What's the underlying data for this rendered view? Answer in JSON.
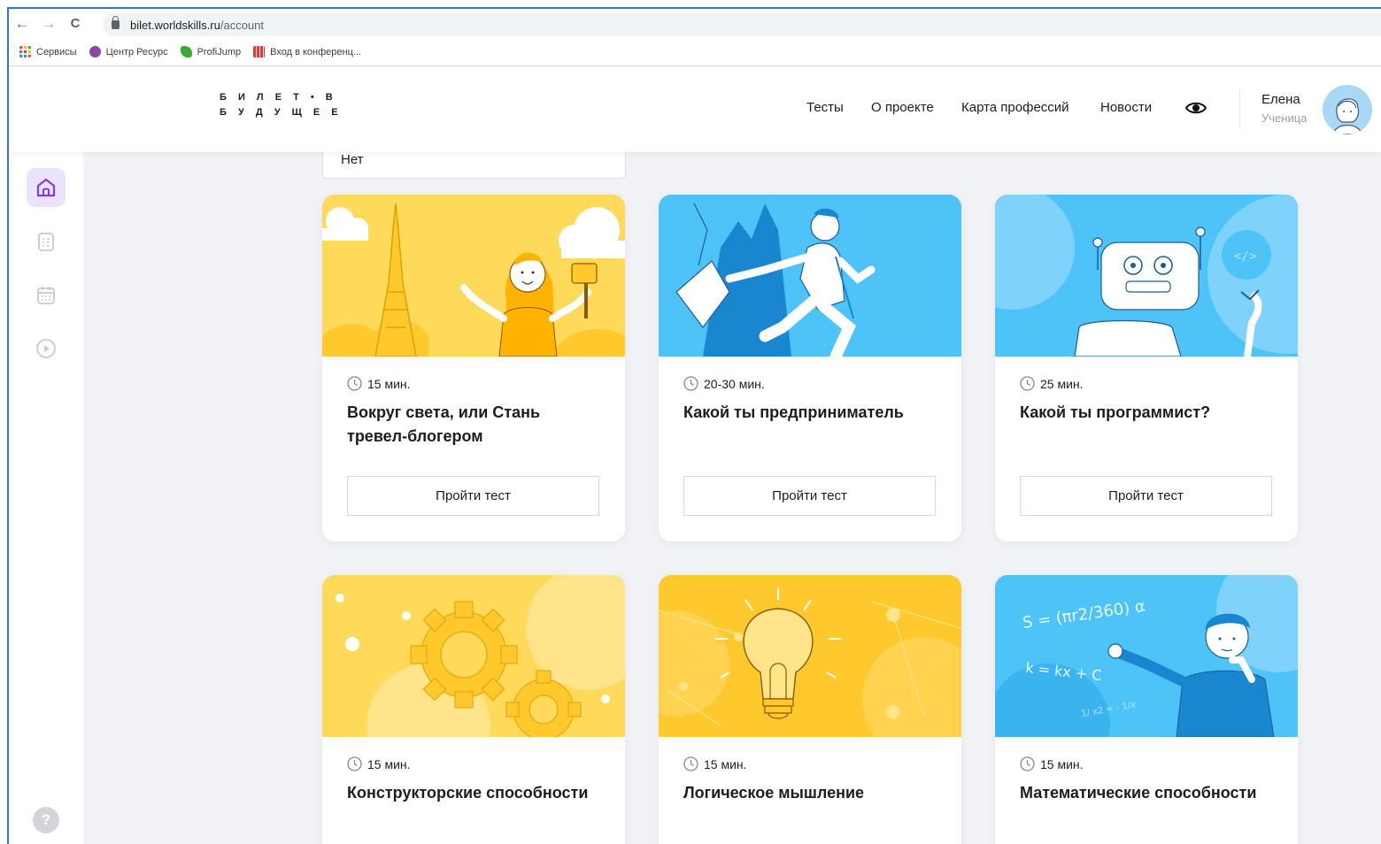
{
  "browser": {
    "url_host": "bilet.worldskills.ru",
    "url_path": "/account",
    "back": "←",
    "forward": "→",
    "reload": "C",
    "bookmarks": [
      {
        "label": "Сервисы",
        "icon": "apps-grid-icon",
        "color": "#e8453c"
      },
      {
        "label": "Центр Ресурс",
        "icon": "resource-center-icon",
        "color": "#8e44ad"
      },
      {
        "label": "ProfiJump",
        "icon": "profijump-icon",
        "color": "#3aaa35"
      },
      {
        "label": "Вход в конференц...",
        "icon": "conference-icon",
        "color": "#e53935"
      }
    ]
  },
  "header": {
    "logo_line1": "Б И Л Е Т • В",
    "logo_line2": "Б У Д У Щ Е Е",
    "nav": [
      "Тесты",
      "О проекте",
      "Карта профессий",
      "Новости"
    ],
    "accessibility_icon": "eye-icon",
    "user_name": "Елена",
    "user_role": "Ученица"
  },
  "sidebar": {
    "items": [
      {
        "icon": "home-icon",
        "active": true
      },
      {
        "icon": "list-icon",
        "active": false
      },
      {
        "icon": "calendar-icon",
        "active": false
      },
      {
        "icon": "play-icon",
        "active": false
      }
    ],
    "help": "?"
  },
  "filter": {
    "value": "Нет"
  },
  "colors": {
    "accent": "#7b3fe4",
    "yellow": "#ffc82c",
    "blue": "#4ec3f7"
  },
  "cards": [
    {
      "duration": "15 мин.",
      "title": "Вокруг света, или Стань тревел-блогером",
      "button": "Пройти тест",
      "illustration": "travel-blogger-illustration"
    },
    {
      "duration": "20-30 мин.",
      "title": "Какой ты предприниматель",
      "button": "Пройти тест",
      "illustration": "entrepreneur-illustration"
    },
    {
      "duration": "25 мин.",
      "title": "Какой ты программист?",
      "button": "Пройти тест",
      "illustration": "robot-illustration"
    },
    {
      "duration": "15 мин.",
      "title": "Конструкторские способности",
      "button": "",
      "illustration": "gears-illustration"
    },
    {
      "duration": "15 мин.",
      "title": "Логическое мышление",
      "button": "",
      "illustration": "lightbulb-illustration"
    },
    {
      "duration": "15 мин.",
      "title": "Математические способности",
      "button": "",
      "illustration": "math-illustration",
      "formulas": [
        "S = (πr2/360) α",
        "k = kx + C",
        "1/ x2 = - 1/x"
      ]
    }
  ]
}
